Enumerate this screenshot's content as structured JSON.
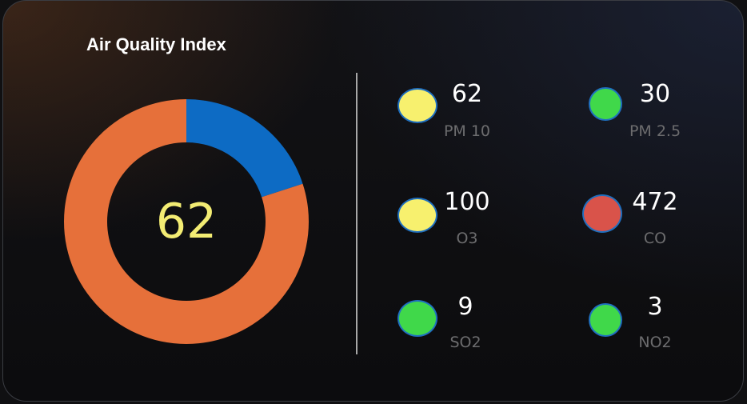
{
  "widget": {
    "title": "Air Quality Index",
    "aqi_value": "62"
  },
  "chart_data": {
    "type": "pie",
    "variant": "donut",
    "segments": [
      {
        "value": 20,
        "color": "#0d6bc4"
      },
      {
        "value": 80,
        "color": "#e6703a"
      }
    ],
    "center_label": "62"
  },
  "metrics": [
    {
      "value": "62",
      "label": "PM 10",
      "color": "#f7f06e"
    },
    {
      "value": "30",
      "label": "PM 2.5",
      "color": "#40d84a"
    },
    {
      "value": "100",
      "label": "O3",
      "color": "#f7f06e"
    },
    {
      "value": "472",
      "label": "CO",
      "color": "#d9534a"
    },
    {
      "value": "9",
      "label": "SO2",
      "color": "#40d84a"
    },
    {
      "value": "3",
      "label": "NO2",
      "color": "#40d84a"
    }
  ],
  "colors": {
    "aqi_text": "#f3ec73",
    "divider": "#a7a7a7",
    "label_text": "#6c6c6e",
    "dot_border": "#1f6fbf"
  }
}
